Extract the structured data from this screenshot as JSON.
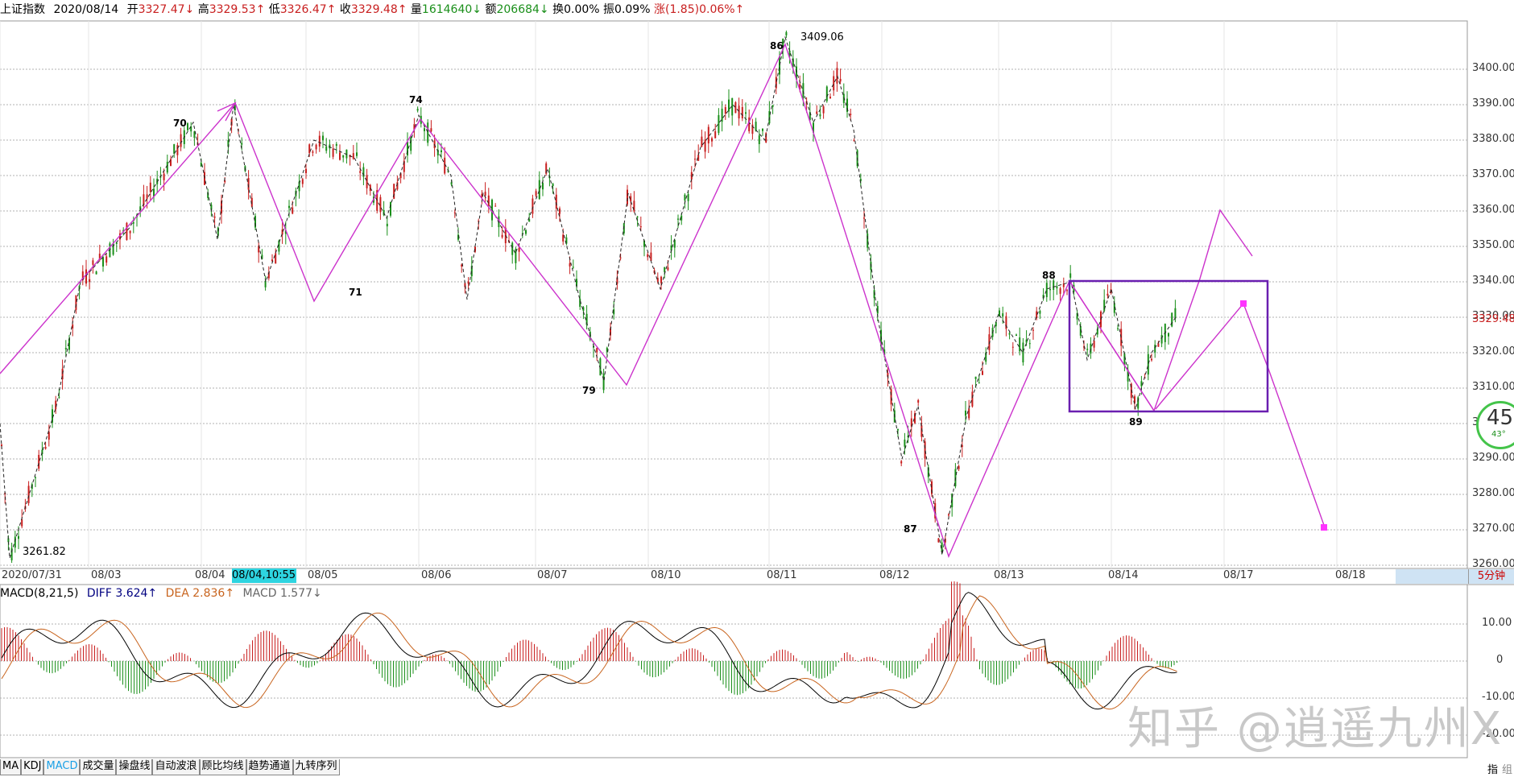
{
  "info_bar": {
    "title": "上证指数",
    "date": "2020/08/14",
    "open_label": "开",
    "open": "3327.47↓",
    "high_label": "高",
    "high": "3329.53↑",
    "low_label": "低",
    "low": "3326.47↑",
    "close_label": "收",
    "close": "3329.48↑",
    "vol_label": "量",
    "vol": "1614640↓",
    "amount_label": "额",
    "amount": "206684↓",
    "turnover_label": "换",
    "turnover": "0.00%",
    "amplitude_label": "振",
    "amplitude": "0.09%",
    "change_label": "涨",
    "change": "(1.85)0.06%↑"
  },
  "price_axis": {
    "ticks": [
      "3400.00",
      "3390.00",
      "3380.00",
      "3370.00",
      "3360.00",
      "3350.00",
      "3340.00",
      "3330.00",
      "3320.00",
      "3310.00",
      "3300.00",
      "3290.00",
      "3280.00",
      "3270.00",
      "3260.00"
    ],
    "current_price": "3329.48"
  },
  "time_axis": {
    "labels": [
      "2020/07/31",
      "08/03",
      "08/04",
      "08/05",
      "08/06",
      "08/07",
      "08/10",
      "08/11",
      "08/12",
      "08/13",
      "08/14",
      "08/17",
      "08/18"
    ],
    "cursor_time": "08/04,10:55",
    "period": "5分钟"
  },
  "annotations": {
    "high_value": "3409.06",
    "low_value": "3261.82",
    "wave_labels": [
      "70",
      "71",
      "74",
      "79",
      "86",
      "87",
      "88",
      "89"
    ]
  },
  "macd": {
    "name": "MACD(8,21,5)",
    "diff": "DIFF 3.624↑",
    "dea": "DEA 2.836↑",
    "macd": "MACD 1.577↓",
    "ticks": [
      "10.00",
      "0",
      "-10.00",
      "-20.00"
    ]
  },
  "tabs": [
    "MA",
    "KDJ",
    "MACD",
    "成交量",
    "操盘线",
    "自动波浪",
    "顾比均线",
    "趋势通道",
    "九转序列"
  ],
  "gauge": {
    "value": "45",
    "sub": "43°"
  },
  "bottom_right": {
    "index": "指",
    "group": "组"
  },
  "watermark": "知乎 @逍遥九州X",
  "colors": {
    "wave_line": "#cc33cc",
    "box": "#6a1fb0",
    "up": "#c81e1e",
    "down": "#1a8f1a",
    "macd_diff": "#000000",
    "macd_dea": "#c8641e"
  },
  "chart_data": {
    "type": "line",
    "title": "上证指数 5分钟",
    "x": [
      "2020/07/31",
      "08/03",
      "08/04",
      "08/05",
      "08/06",
      "08/07",
      "08/10",
      "08/11",
      "08/12",
      "08/13",
      "08/14",
      "08/17",
      "08/18"
    ],
    "wave_points": [
      {
        "label": "70",
        "t": "08/04",
        "price": 3391
      },
      {
        "label": "71",
        "t": "08/05",
        "price": 3335
      },
      {
        "label": "74",
        "t": "08/06",
        "price": 3387
      },
      {
        "label": "79",
        "t": "08/07",
        "price": 3312
      },
      {
        "label": "86",
        "t": "08/11",
        "price": 3409.06
      },
      {
        "label": "87",
        "t": "08/12",
        "price": 3263
      },
      {
        "label": "88",
        "t": "08/13",
        "price": 3340
      },
      {
        "label": "89",
        "t": "08/14",
        "price": 3304
      }
    ],
    "low": 3261.82,
    "high": 3409.06,
    "current": 3329.48,
    "ylim": [
      3260,
      3410
    ]
  }
}
